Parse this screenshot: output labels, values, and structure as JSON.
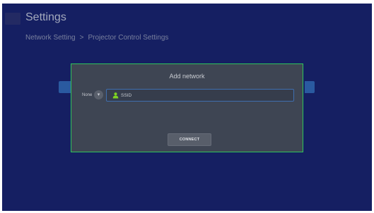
{
  "header": {
    "title": "Settings",
    "breadcrumb": {
      "parent": "Network Setting",
      "separator": ">",
      "current": "Projector Control Settings"
    }
  },
  "dialog": {
    "title": "Add network",
    "security": {
      "selected": "None",
      "dropdown_icon": "chevron-down-icon"
    },
    "ssid": {
      "placeholder": "SSID",
      "value": "",
      "icon": "user-icon"
    },
    "connect_label": "CONNECT"
  },
  "colors": {
    "background": "#151f62",
    "dialog_bg": "#3e4553",
    "dialog_border": "#2fc45b",
    "field_border": "#3f6eae",
    "icon_green": "#7ed321"
  }
}
